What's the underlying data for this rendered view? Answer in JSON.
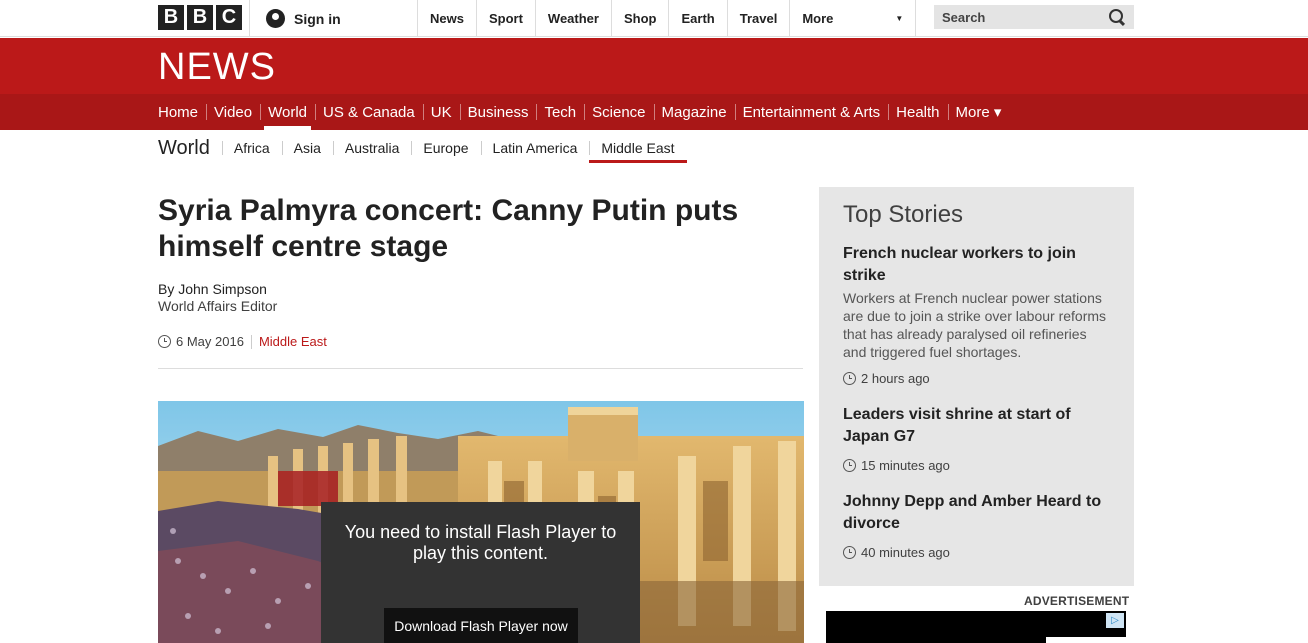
{
  "global": {
    "logo_letters": [
      "B",
      "B",
      "C"
    ],
    "sign_in": "Sign in",
    "nav": [
      "News",
      "Sport",
      "Weather",
      "Shop",
      "Earth",
      "Travel"
    ],
    "more": "More",
    "search_placeholder": "Search"
  },
  "news": {
    "title": "NEWS",
    "nav": [
      {
        "label": "Home",
        "active": false
      },
      {
        "label": "Video",
        "active": false
      },
      {
        "label": "World",
        "active": true
      },
      {
        "label": "US & Canada",
        "active": false
      },
      {
        "label": "UK",
        "active": false
      },
      {
        "label": "Business",
        "active": false
      },
      {
        "label": "Tech",
        "active": false
      },
      {
        "label": "Science",
        "active": false
      },
      {
        "label": "Magazine",
        "active": false
      },
      {
        "label": "Entertainment & Arts",
        "active": false
      },
      {
        "label": "Health",
        "active": false
      }
    ],
    "nav_more": "More ▾"
  },
  "section": {
    "title": "World",
    "items": [
      "Africa",
      "Asia",
      "Australia",
      "Europe",
      "Latin America",
      "Middle East"
    ],
    "active_index": 5
  },
  "article": {
    "headline": "Syria Palmyra concert: Canny Putin puts himself centre stage",
    "author": "By John Simpson",
    "role": "World Affairs Editor",
    "date": "6 May 2016",
    "section": "Middle East"
  },
  "media": {
    "flash_message": "You need to install Flash Player to play this content.",
    "download_button": "Download Flash Player now"
  },
  "sidebar": {
    "title": "Top Stories",
    "stories": [
      {
        "headline": "French nuclear workers to join strike",
        "summary": "Workers at French nuclear power stations are due to join a strike over labour reforms that has already paralysed oil refineries and triggered fuel shortages.",
        "time": "2 hours ago"
      },
      {
        "headline": "Leaders visit shrine at start of Japan G7",
        "summary": "",
        "time": "15 minutes ago"
      },
      {
        "headline": "Johnny Depp and Amber Heard to divorce",
        "summary": "",
        "time": "40 minutes ago"
      }
    ]
  },
  "advert": {
    "label": "ADVERTISEMENT"
  },
  "colors": {
    "brand_red": "#bb1919",
    "nav_red": "#a91717"
  }
}
